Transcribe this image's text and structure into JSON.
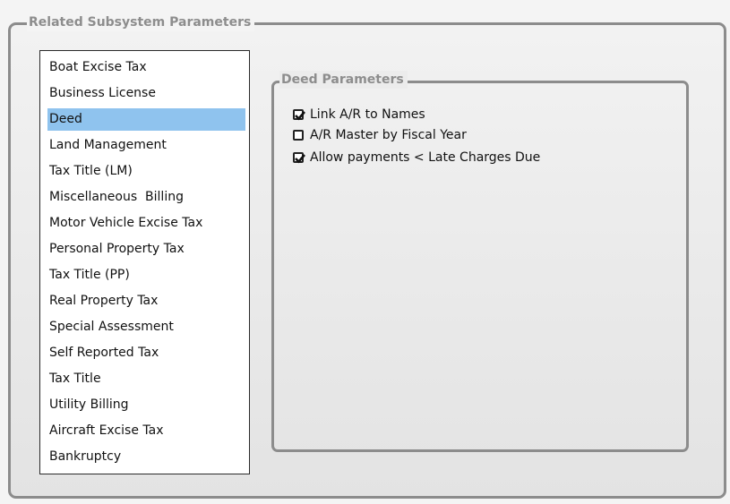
{
  "outer_group": {
    "title": "Related Subsystem Parameters"
  },
  "subsystems": {
    "selected_index": 2,
    "items": [
      "Boat Excise Tax",
      "Business License",
      "Deed",
      "Land Management",
      "Tax Title (LM)",
      "Miscellaneous  Billing",
      "Motor Vehicle Excise Tax",
      "Personal Property Tax",
      "Tax Title (PP)",
      "Real Property Tax",
      "Special Assessment",
      "Self Reported Tax",
      "Tax Title",
      "Utility Billing",
      "Aircraft Excise Tax",
      "Bankruptcy"
    ]
  },
  "deed_parameters": {
    "title": "Deed Parameters",
    "options": [
      {
        "label": "Link A/R to Names",
        "checked": true
      },
      {
        "label": "A/R Master by Fiscal Year",
        "checked": false
      },
      {
        "label": "Allow payments < Late Charges Due",
        "checked": true
      }
    ]
  },
  "colors": {
    "selection": "#8fc3ee",
    "group_border": "#8c8c8c",
    "legend_text": "#8d8d8d"
  }
}
